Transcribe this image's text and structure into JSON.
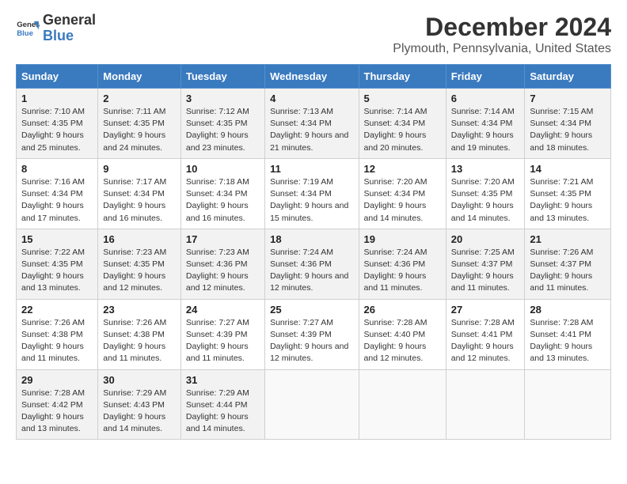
{
  "logo": {
    "line1": "General",
    "line2": "Blue"
  },
  "title": "December 2024",
  "subtitle": "Plymouth, Pennsylvania, United States",
  "headers": [
    "Sunday",
    "Monday",
    "Tuesday",
    "Wednesday",
    "Thursday",
    "Friday",
    "Saturday"
  ],
  "weeks": [
    [
      {
        "day": "1",
        "sunrise": "7:10 AM",
        "sunset": "4:35 PM",
        "daylight": "9 hours and 25 minutes."
      },
      {
        "day": "2",
        "sunrise": "7:11 AM",
        "sunset": "4:35 PM",
        "daylight": "9 hours and 24 minutes."
      },
      {
        "day": "3",
        "sunrise": "7:12 AM",
        "sunset": "4:35 PM",
        "daylight": "9 hours and 23 minutes."
      },
      {
        "day": "4",
        "sunrise": "7:13 AM",
        "sunset": "4:34 PM",
        "daylight": "9 hours and 21 minutes."
      },
      {
        "day": "5",
        "sunrise": "7:14 AM",
        "sunset": "4:34 PM",
        "daylight": "9 hours and 20 minutes."
      },
      {
        "day": "6",
        "sunrise": "7:14 AM",
        "sunset": "4:34 PM",
        "daylight": "9 hours and 19 minutes."
      },
      {
        "day": "7",
        "sunrise": "7:15 AM",
        "sunset": "4:34 PM",
        "daylight": "9 hours and 18 minutes."
      }
    ],
    [
      {
        "day": "8",
        "sunrise": "7:16 AM",
        "sunset": "4:34 PM",
        "daylight": "9 hours and 17 minutes."
      },
      {
        "day": "9",
        "sunrise": "7:17 AM",
        "sunset": "4:34 PM",
        "daylight": "9 hours and 16 minutes."
      },
      {
        "day": "10",
        "sunrise": "7:18 AM",
        "sunset": "4:34 PM",
        "daylight": "9 hours and 16 minutes."
      },
      {
        "day": "11",
        "sunrise": "7:19 AM",
        "sunset": "4:34 PM",
        "daylight": "9 hours and 15 minutes."
      },
      {
        "day": "12",
        "sunrise": "7:20 AM",
        "sunset": "4:34 PM",
        "daylight": "9 hours and 14 minutes."
      },
      {
        "day": "13",
        "sunrise": "7:20 AM",
        "sunset": "4:35 PM",
        "daylight": "9 hours and 14 minutes."
      },
      {
        "day": "14",
        "sunrise": "7:21 AM",
        "sunset": "4:35 PM",
        "daylight": "9 hours and 13 minutes."
      }
    ],
    [
      {
        "day": "15",
        "sunrise": "7:22 AM",
        "sunset": "4:35 PM",
        "daylight": "9 hours and 13 minutes."
      },
      {
        "day": "16",
        "sunrise": "7:23 AM",
        "sunset": "4:35 PM",
        "daylight": "9 hours and 12 minutes."
      },
      {
        "day": "17",
        "sunrise": "7:23 AM",
        "sunset": "4:36 PM",
        "daylight": "9 hours and 12 minutes."
      },
      {
        "day": "18",
        "sunrise": "7:24 AM",
        "sunset": "4:36 PM",
        "daylight": "9 hours and 12 minutes."
      },
      {
        "day": "19",
        "sunrise": "7:24 AM",
        "sunset": "4:36 PM",
        "daylight": "9 hours and 11 minutes."
      },
      {
        "day": "20",
        "sunrise": "7:25 AM",
        "sunset": "4:37 PM",
        "daylight": "9 hours and 11 minutes."
      },
      {
        "day": "21",
        "sunrise": "7:26 AM",
        "sunset": "4:37 PM",
        "daylight": "9 hours and 11 minutes."
      }
    ],
    [
      {
        "day": "22",
        "sunrise": "7:26 AM",
        "sunset": "4:38 PM",
        "daylight": "9 hours and 11 minutes."
      },
      {
        "day": "23",
        "sunrise": "7:26 AM",
        "sunset": "4:38 PM",
        "daylight": "9 hours and 11 minutes."
      },
      {
        "day": "24",
        "sunrise": "7:27 AM",
        "sunset": "4:39 PM",
        "daylight": "9 hours and 11 minutes."
      },
      {
        "day": "25",
        "sunrise": "7:27 AM",
        "sunset": "4:39 PM",
        "daylight": "9 hours and 12 minutes."
      },
      {
        "day": "26",
        "sunrise": "7:28 AM",
        "sunset": "4:40 PM",
        "daylight": "9 hours and 12 minutes."
      },
      {
        "day": "27",
        "sunrise": "7:28 AM",
        "sunset": "4:41 PM",
        "daylight": "9 hours and 12 minutes."
      },
      {
        "day": "28",
        "sunrise": "7:28 AM",
        "sunset": "4:41 PM",
        "daylight": "9 hours and 13 minutes."
      }
    ],
    [
      {
        "day": "29",
        "sunrise": "7:28 AM",
        "sunset": "4:42 PM",
        "daylight": "9 hours and 13 minutes."
      },
      {
        "day": "30",
        "sunrise": "7:29 AM",
        "sunset": "4:43 PM",
        "daylight": "9 hours and 14 minutes."
      },
      {
        "day": "31",
        "sunrise": "7:29 AM",
        "sunset": "4:44 PM",
        "daylight": "9 hours and 14 minutes."
      },
      null,
      null,
      null,
      null
    ]
  ]
}
